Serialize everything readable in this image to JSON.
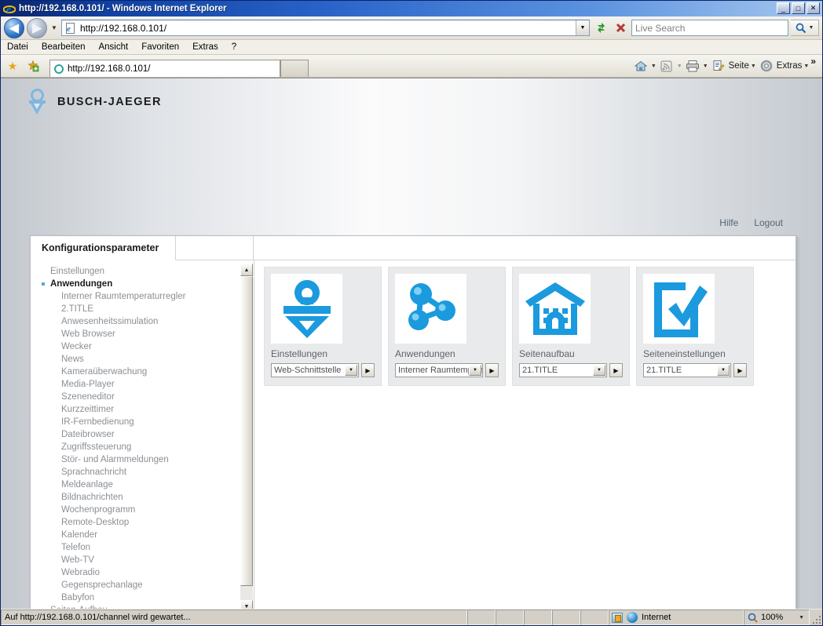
{
  "window": {
    "title": "http://192.168.0.101/ - Windows Internet Explorer",
    "minimize_label": "_",
    "maximize_label": "□",
    "close_label": "✕"
  },
  "nav": {
    "back_label": "◀",
    "forward_label": "▶",
    "history_caret": "▼",
    "address_value": "http://192.168.0.101/",
    "address_dropdown_caret": "▼",
    "refresh_label": "↻",
    "stop_label": "✕",
    "search_placeholder": "Live Search",
    "search_go_caret": "▼"
  },
  "menubar": {
    "items": [
      "Datei",
      "Bearbeiten",
      "Ansicht",
      "Favoriten",
      "Extras",
      "?"
    ]
  },
  "favbar": {
    "favorites_center_icon": "star-icon",
    "add_favorite_icon": "add-favorite-icon",
    "tab_label": "http://192.168.0.101/",
    "new_tab_label": ""
  },
  "toolbar_right": {
    "home_label": "",
    "feeds_label": "",
    "print_label": "",
    "page_label": "Seite",
    "tools_label": "Extras",
    "overflow_label": "»",
    "caret": "▼"
  },
  "page": {
    "brand": "BUSCH-JAEGER",
    "links": [
      {
        "label": "Hilfe"
      },
      {
        "label": "Logout"
      }
    ],
    "tab_label": "Konfigurationsparameter",
    "sidebar": {
      "items": [
        {
          "label": "Einstellungen",
          "level": 0,
          "active": false
        },
        {
          "label": "Anwendungen",
          "level": 0,
          "active": true
        },
        {
          "label": "Interner Raumtemperaturregler",
          "level": 1,
          "active": false
        },
        {
          "label": "2.TITLE",
          "level": 1,
          "active": false
        },
        {
          "label": "Anwesenheitssimulation",
          "level": 1,
          "active": false
        },
        {
          "label": "Web Browser",
          "level": 1,
          "active": false
        },
        {
          "label": "Wecker",
          "level": 1,
          "active": false
        },
        {
          "label": "News",
          "level": 1,
          "active": false
        },
        {
          "label": "Kameraüberwachung",
          "level": 1,
          "active": false
        },
        {
          "label": "Media-Player",
          "level": 1,
          "active": false
        },
        {
          "label": "Szeneneditor",
          "level": 1,
          "active": false
        },
        {
          "label": "Kurzzeittimer",
          "level": 1,
          "active": false
        },
        {
          "label": "IR-Fernbedienung",
          "level": 1,
          "active": false
        },
        {
          "label": "Dateibrowser",
          "level": 1,
          "active": false
        },
        {
          "label": "Zugriffssteuerung",
          "level": 1,
          "active": false
        },
        {
          "label": "Stör- und Alarmmeldungen",
          "level": 1,
          "active": false
        },
        {
          "label": "Sprachnachricht",
          "level": 1,
          "active": false
        },
        {
          "label": "Meldeanlage",
          "level": 1,
          "active": false
        },
        {
          "label": "Bildnachrichten",
          "level": 1,
          "active": false
        },
        {
          "label": "Wochenprogramm",
          "level": 1,
          "active": false
        },
        {
          "label": "Remote-Desktop",
          "level": 1,
          "active": false
        },
        {
          "label": "Kalender",
          "level": 1,
          "active": false
        },
        {
          "label": "Telefon",
          "level": 1,
          "active": false
        },
        {
          "label": "Web-TV",
          "level": 1,
          "active": false
        },
        {
          "label": "Webradio",
          "level": 1,
          "active": false
        },
        {
          "label": "Gegensprechanlage",
          "level": 1,
          "active": false
        },
        {
          "label": "Babyfon",
          "level": 1,
          "active": false
        },
        {
          "label": "Seiten-Aufbau",
          "level": 0,
          "active": false
        }
      ],
      "scroll_up_caret": "▲",
      "scroll_down_caret": "▼"
    },
    "cards": [
      {
        "icon": "busch-jaeger-logo-icon",
        "title": "Einstellungen",
        "select_value": "Web-Schnittstelle",
        "select_caret": "▼",
        "go_label": "▶"
      },
      {
        "icon": "molecule-icon",
        "title": "Anwendungen",
        "select_value": "Interner Raumtemperaturregler",
        "select_caret": "▼",
        "go_label": "▶"
      },
      {
        "icon": "house-icon",
        "title": "Seitenaufbau",
        "select_value": "21.TITLE",
        "select_caret": "▼",
        "go_label": "▶"
      },
      {
        "icon": "checklist-icon",
        "title": "Seiteneinstellungen",
        "select_value": "21.TITLE",
        "select_caret": "▼",
        "go_label": "▶"
      }
    ],
    "accent_color": "#1b9ade",
    "logo_color": "#7fb7e0"
  },
  "statusbar": {
    "message": "Auf http://192.168.0.101/channel wird gewartet...",
    "zone": "Internet",
    "zoom": "100%",
    "zoom_caret": "▼"
  }
}
